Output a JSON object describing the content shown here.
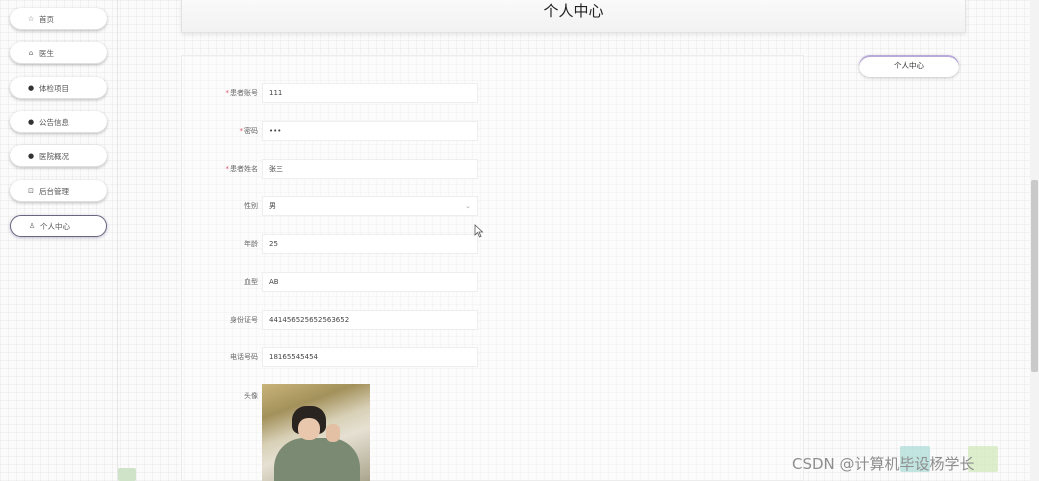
{
  "sidebar": {
    "items": [
      {
        "icon": "☆",
        "icon_name": "star-icon",
        "label": "首页"
      },
      {
        "icon": "⌂",
        "icon_name": "lock-icon",
        "label": "医生"
      },
      {
        "icon": "●",
        "icon_name": "dot-icon",
        "label": "体检项目"
      },
      {
        "icon": "●",
        "icon_name": "dot-icon",
        "label": "公告信息"
      },
      {
        "icon": "●",
        "icon_name": "dot-icon",
        "label": "医院概况"
      },
      {
        "icon": "⊡",
        "icon_name": "calendar-icon",
        "label": "后台管理"
      },
      {
        "icon": "♙",
        "icon_name": "user-icon",
        "label": "个人中心"
      }
    ],
    "active_index": 6
  },
  "header": {
    "title": "个人中心"
  },
  "form": {
    "fields": [
      {
        "label": "患者账号",
        "required": "*",
        "value": "111"
      },
      {
        "label": "密码",
        "required": "*",
        "value": "•••"
      },
      {
        "label": "患者姓名",
        "required": "*",
        "value": "张三"
      },
      {
        "label": "性别",
        "required": "",
        "value": "男"
      },
      {
        "label": "年龄",
        "required": "",
        "value": "25"
      },
      {
        "label": "血型",
        "required": "",
        "value": "AB"
      },
      {
        "label": "身份证号",
        "required": "",
        "value": "441456525652563652"
      },
      {
        "label": "电话号码",
        "required": "",
        "value": "18165545454"
      }
    ],
    "avatar_label": "头像",
    "select_chevron": "⌄"
  },
  "right_button": {
    "label": "个人中心"
  },
  "watermark": "CSDN @计算机毕设杨学长",
  "colors": {
    "accent": "#b7a9d8",
    "required": "#e0566b",
    "active_border": "#6b6680"
  }
}
